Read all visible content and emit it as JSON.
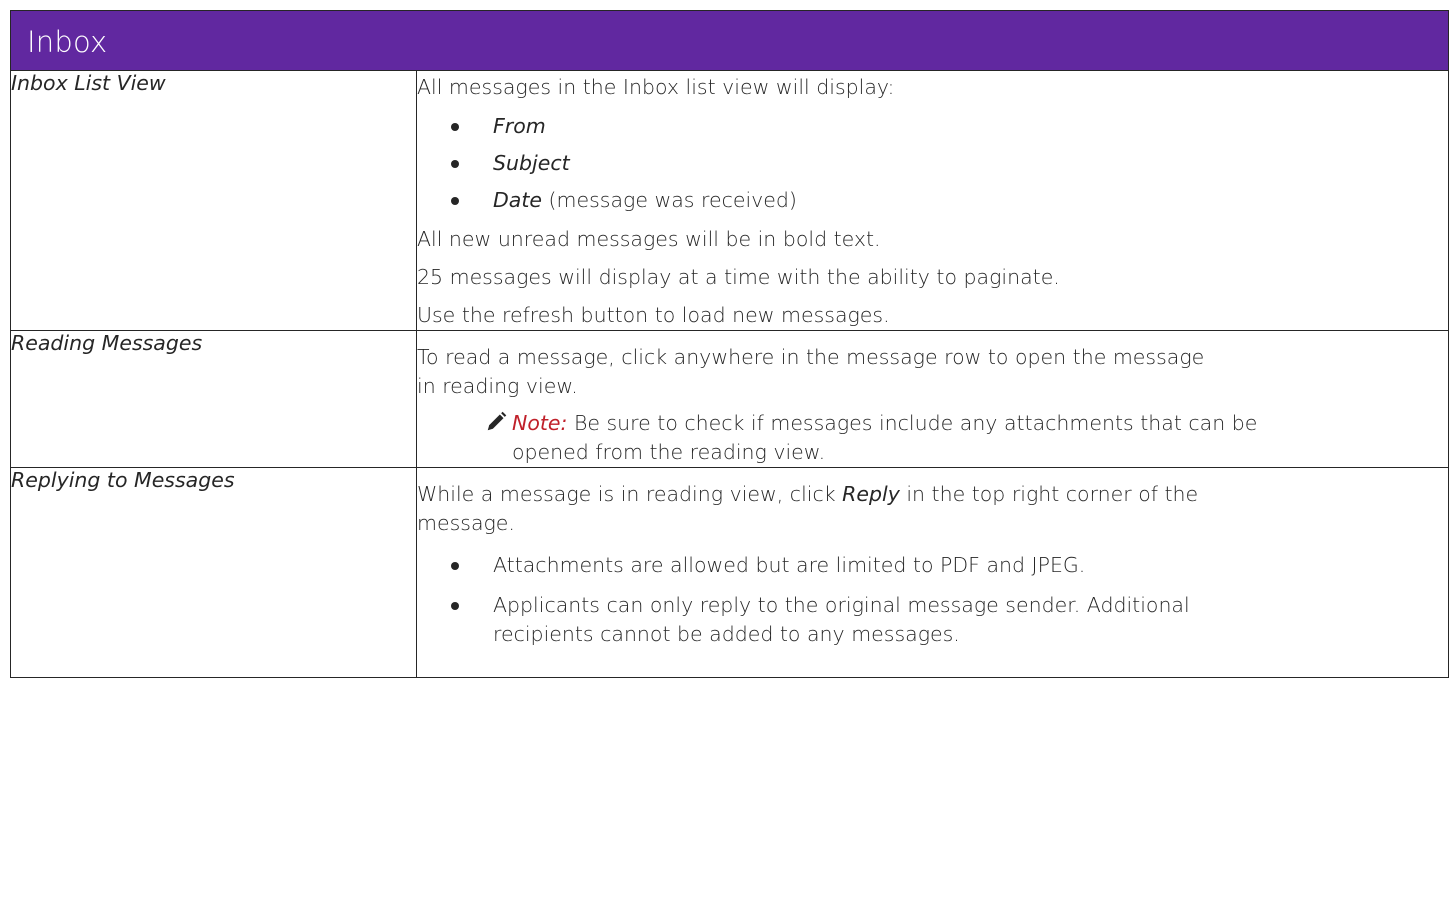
{
  "title": "Inbox",
  "colors": {
    "header_bg": "#6128a0",
    "header_text": "#ffffff",
    "note_label": "#c0202a",
    "border": "#262626"
  },
  "rows": [
    {
      "topic": "Inbox List View",
      "intro": "All messages in the Inbox list view will display:",
      "bullets": [
        {
          "term": "From",
          "rest": ""
        },
        {
          "term": "Subject",
          "rest": ""
        },
        {
          "term": "Date",
          "rest": " (message was received)"
        }
      ],
      "paragraphs": [
        "All new unread messages will be in bold text.",
        "25 messages will display at a time with the ability to paginate.",
        "Use the refresh button to load new messages."
      ]
    },
    {
      "topic": "Reading Messages",
      "text_line1": "To read a message, click anywhere in the message row to open the message",
      "text_line2": "in reading view.",
      "note_label": "Note:",
      "note_line1": " Be sure to check if messages include any attachments that can be",
      "note_line2": "opened from the reading view.",
      "note_icon": "pencil-icon"
    },
    {
      "topic": "Replying to Messages",
      "text_before": "While a message is in reading view, click ",
      "text_term": "Reply",
      "text_after_line1": " in the top right corner of the",
      "text_line2": "message.",
      "bullets": [
        {
          "line1": "Attachments are allowed but are limited to PDF and JPEG.",
          "line2": ""
        },
        {
          "line1": "Applicants can only reply to the original message sender. Additional",
          "line2": "recipients cannot be added to any messages."
        }
      ]
    }
  ]
}
